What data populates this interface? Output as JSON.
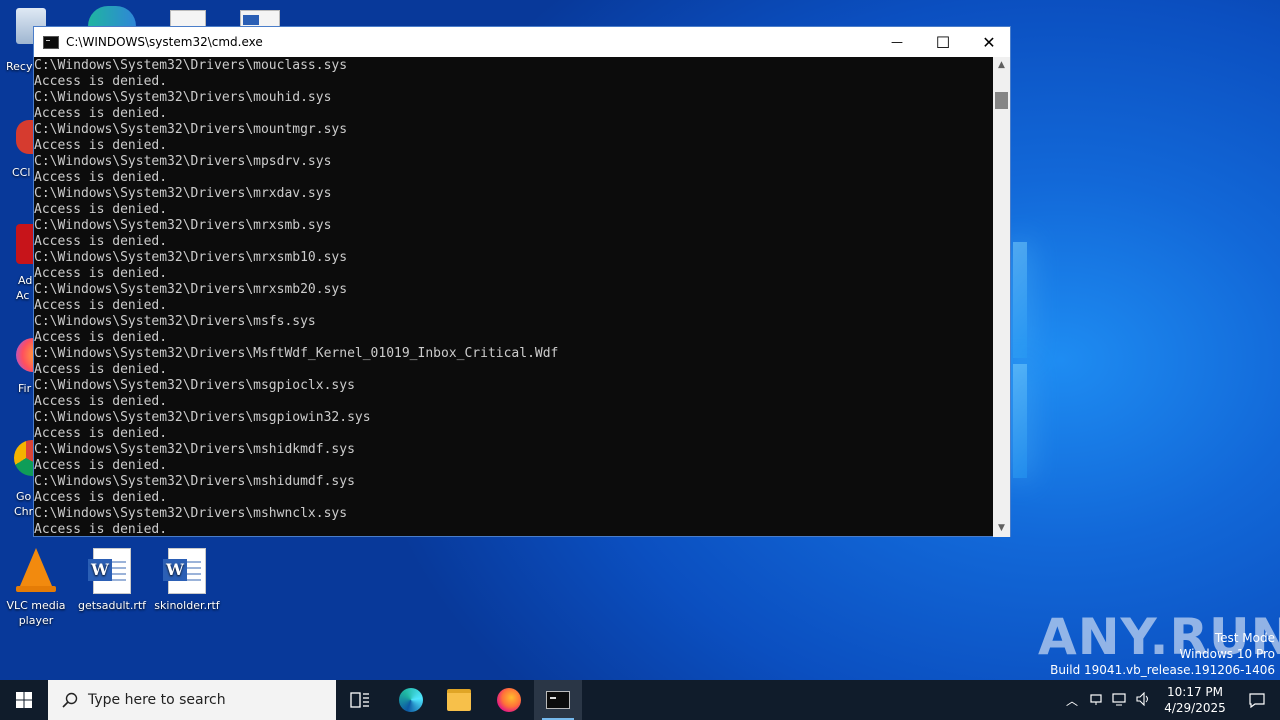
{
  "desktop": {
    "icons": [
      {
        "label": "VLC media player"
      },
      {
        "label": "getsadult.rtf"
      },
      {
        "label": "skinolder.rtf"
      }
    ],
    "partial_labels": [
      "Recy",
      "CCl",
      "Ad",
      "Ac",
      "Fir",
      "Go",
      "Chr"
    ]
  },
  "window": {
    "title": "C:\\WINDOWS\\system32\\cmd.exe",
    "minimize_glyph": "—",
    "maximize_glyph": "☐",
    "close_glyph": "✕"
  },
  "console": {
    "lines": [
      "C:\\Windows\\System32\\Drivers\\mouclass.sys",
      "Access is denied.",
      "C:\\Windows\\System32\\Drivers\\mouhid.sys",
      "Access is denied.",
      "C:\\Windows\\System32\\Drivers\\mountmgr.sys",
      "Access is denied.",
      "C:\\Windows\\System32\\Drivers\\mpsdrv.sys",
      "Access is denied.",
      "C:\\Windows\\System32\\Drivers\\mrxdav.sys",
      "Access is denied.",
      "C:\\Windows\\System32\\Drivers\\mrxsmb.sys",
      "Access is denied.",
      "C:\\Windows\\System32\\Drivers\\mrxsmb10.sys",
      "Access is denied.",
      "C:\\Windows\\System32\\Drivers\\mrxsmb20.sys",
      "Access is denied.",
      "C:\\Windows\\System32\\Drivers\\msfs.sys",
      "Access is denied.",
      "C:\\Windows\\System32\\Drivers\\MsftWdf_Kernel_01019_Inbox_Critical.Wdf",
      "Access is denied.",
      "C:\\Windows\\System32\\Drivers\\msgpioclx.sys",
      "Access is denied.",
      "C:\\Windows\\System32\\Drivers\\msgpiowin32.sys",
      "Access is denied.",
      "C:\\Windows\\System32\\Drivers\\mshidkmdf.sys",
      "Access is denied.",
      "C:\\Windows\\System32\\Drivers\\mshidumdf.sys",
      "Access is denied.",
      "C:\\Windows\\System32\\Drivers\\mshwnclx.sys",
      "Access is denied."
    ]
  },
  "watermark": {
    "brand": "ANY.RUN",
    "mode": "Test Mode",
    "os": "Windows 10 Pro",
    "build": "Build 19041.vb_release.191206-1406"
  },
  "taskbar": {
    "search_placeholder": "Type here to search",
    "time": "10:17 PM",
    "date": "4/29/2025"
  },
  "colors": {
    "console_bg": "#0c0c0c",
    "console_fg": "#cccccc",
    "taskbar_bg": "#101c2b",
    "accent": "#76b9ed"
  }
}
